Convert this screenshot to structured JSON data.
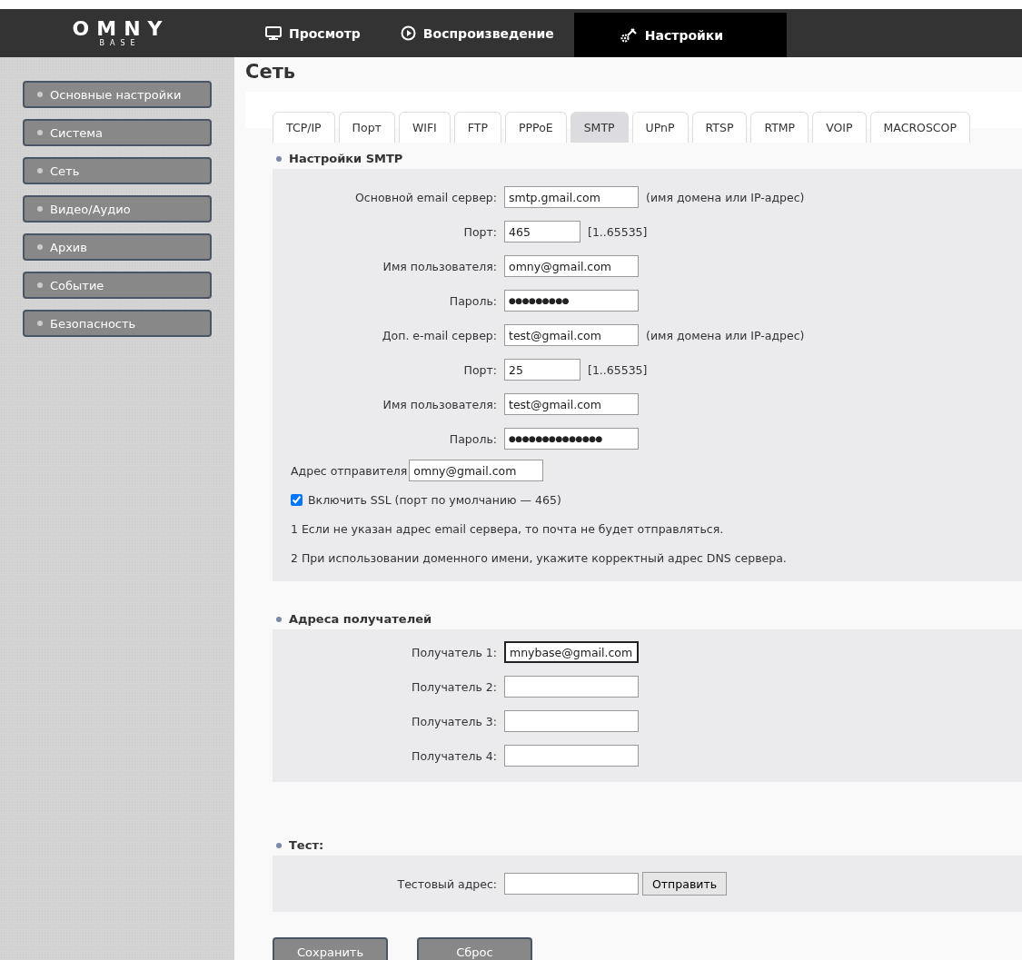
{
  "header": {
    "logo": "OMNY",
    "logo_sub": "BASE",
    "nav": [
      {
        "label": "Просмотр",
        "selected": false
      },
      {
        "label": "Воспроизведение",
        "selected": false
      },
      {
        "label": "Настройки",
        "selected": true
      }
    ]
  },
  "sidebar": {
    "items": [
      {
        "label": "Основные настройки"
      },
      {
        "label": "Система"
      },
      {
        "label": "Сеть"
      },
      {
        "label": "Видео/Аудио"
      },
      {
        "label": "Архив"
      },
      {
        "label": "Событие"
      },
      {
        "label": "Безопасность"
      }
    ]
  },
  "page": {
    "title": "Сеть"
  },
  "tabs": [
    {
      "label": "TCP/IP",
      "selected": false
    },
    {
      "label": "Порт",
      "selected": false
    },
    {
      "label": "WIFI",
      "selected": false
    },
    {
      "label": "FTP",
      "selected": false
    },
    {
      "label": "PPPoE",
      "selected": false
    },
    {
      "label": "SMTP",
      "selected": true
    },
    {
      "label": "UPnP",
      "selected": false
    },
    {
      "label": "RTSP",
      "selected": false
    },
    {
      "label": "RTMP",
      "selected": false
    },
    {
      "label": "VOIP",
      "selected": false
    },
    {
      "label": "MACROSCOP",
      "selected": false
    }
  ],
  "smtp": {
    "title": "Настройки SMTP",
    "fields": [
      {
        "label": "Основной email сервер:",
        "value": "smtp.gmail.com",
        "kind": "wide",
        "hint": "(имя домена или IP-адрес)"
      },
      {
        "label": "Порт:",
        "value": "465",
        "kind": "short",
        "hint": "[1..65535]"
      },
      {
        "label": "Имя пользователя:",
        "value": "omny@gmail.com",
        "kind": "wide"
      },
      {
        "label": "Пароль:",
        "value": "●●●●●●●●●",
        "kind": "secret"
      },
      {
        "label": "Доп. e-mail сервер:",
        "value": "test@gmail.com",
        "kind": "wide",
        "hint": "(имя домена или IP-адрес)"
      },
      {
        "label": "Порт:",
        "value": "25",
        "kind": "short",
        "hint": "[1..65535]"
      },
      {
        "label": "Имя пользователя:",
        "value": "test@gmail.com",
        "kind": "wide"
      },
      {
        "label": "Пароль:",
        "value": "●●●●●●●●●●●●●●",
        "kind": "secret"
      }
    ],
    "sender": {
      "label": "Адрес отправителя",
      "value": "omny@gmail.com"
    },
    "ssl": {
      "label": "Включить SSL (порт по умолчанию — 465)",
      "checked": true
    },
    "notes": [
      "1 Если не указан адрес email сервера, то почта не будет отправляться.",
      "2 При использовании доменного имени, укажите корректный адрес DNS сервера."
    ]
  },
  "recipients": {
    "title": "Адреса получателей",
    "fields": [
      {
        "label": "Получатель 1:",
        "value": "mnybase@gmail.com",
        "focused": true
      },
      {
        "label": "Получатель 2:",
        "focused": false
      },
      {
        "label": "Получатель 3:",
        "focused": false
      },
      {
        "label": "Получатель 4:",
        "focused": false
      }
    ]
  },
  "test": {
    "title": "Тест:",
    "label": "Тестовый адрес:",
    "button": "Отправить"
  },
  "buttons": [
    "Сохранить",
    "Сброс"
  ]
}
